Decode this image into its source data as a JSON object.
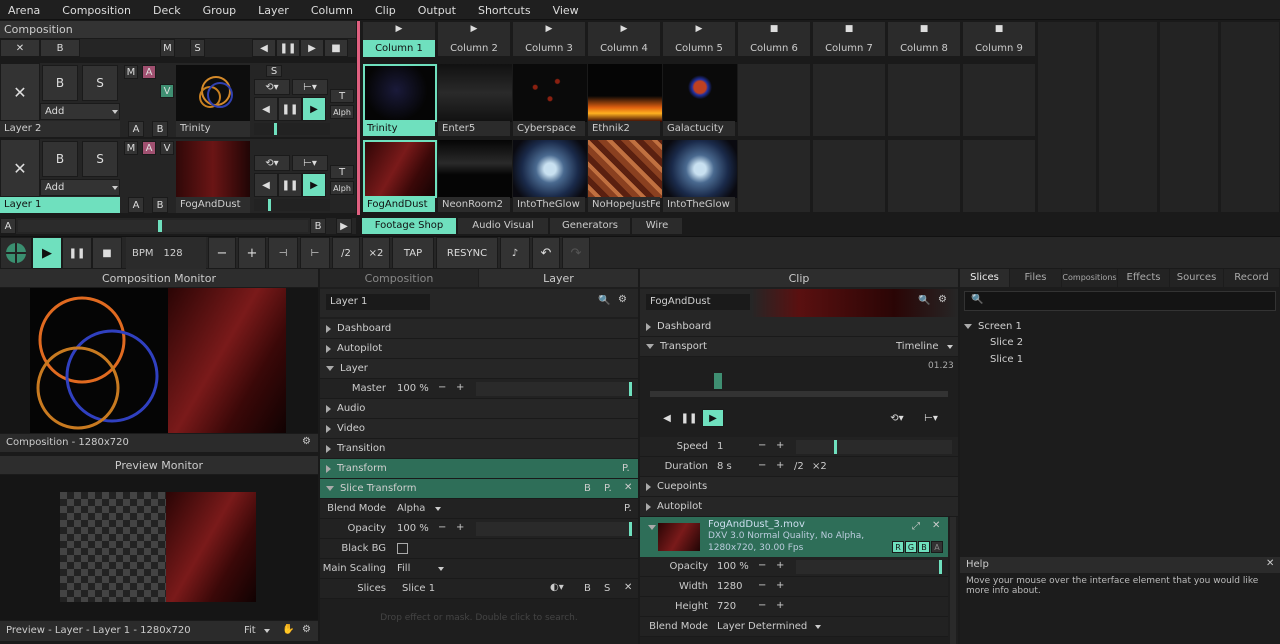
{
  "menu": [
    "Arena",
    "Composition",
    "Deck",
    "Group",
    "Layer",
    "Column",
    "Clip",
    "Output",
    "Shortcuts",
    "View"
  ],
  "composition_label": "Composition",
  "columns": [
    "Column 1",
    "Column 2",
    "Column 3",
    "Column 4",
    "Column 5",
    "Column 6",
    "Column 7",
    "Column 8",
    "Column 9"
  ],
  "layer2": {
    "name": "Layer 2",
    "add": "Add",
    "clip": "Trinity",
    "clips": [
      "Trinity",
      "Enter5",
      "Cyberspace",
      "Ethnik2",
      "Galactucity"
    ]
  },
  "layer1": {
    "name": "Layer 1",
    "add": "Add",
    "clip": "FogAndDust",
    "clips": [
      "FogAndDust",
      "NeonRoom2",
      "IntoTheGlow",
      "NoHopeJustFear",
      "IntoTheGlow"
    ]
  },
  "letters": {
    "b": "B",
    "s": "S",
    "m": "M",
    "a": "A",
    "v": "V",
    "t": "T",
    "alph": "Alph",
    "x": "✕"
  },
  "tabs_bottom": [
    "Footage Shop",
    "Audio Visual",
    "Generators",
    "Wire"
  ],
  "transport": {
    "bpm_label": "BPM",
    "bpm": "128",
    "minus": "−",
    "plus": "+",
    "half": "/2",
    "double": "×2",
    "tap": "TAP",
    "resync": "RESYNC"
  },
  "comp_monitor": {
    "title": "Composition Monitor",
    "footer": "Composition - 1280x720"
  },
  "preview_monitor": {
    "title": "Preview Monitor",
    "footer": "Preview - Layer - Layer 1 - 1280x720",
    "fit": "Fit"
  },
  "layer_panel": {
    "tab_comp": "Composition",
    "tab_layer": "Layer",
    "search": "Layer 1",
    "sections": [
      "Dashboard",
      "Autopilot",
      "Layer"
    ],
    "master_label": "Master",
    "master_val": "100 %",
    "sections2": [
      "Audio",
      "Video",
      "Transition",
      "Transform",
      "Slice Transform"
    ],
    "blend_label": "Blend Mode",
    "blend_val": "Alpha",
    "opacity_label": "Opacity",
    "opacity_val": "100 %",
    "blackbg_label": "Black BG",
    "scaling_label": "Main Scaling",
    "scaling_val": "Fill",
    "slices_label": "Slices",
    "slices_val": "Slice 1",
    "drop_hint": "Drop effect or mask. Double click to search."
  },
  "clip_panel": {
    "title": "Clip",
    "search": "FogAndDust",
    "dashboard": "Dashboard",
    "transport": "Transport",
    "timeline": "Timeline",
    "time": "01.23",
    "speed_label": "Speed",
    "speed_val": "1",
    "duration_label": "Duration",
    "duration_val": "8 s",
    "cuepoints": "Cuepoints",
    "autopilot": "Autopilot",
    "file": "FogAndDust_3.mov",
    "codec": "DXV 3.0 Normal Quality, No Alpha,",
    "res": "1280x720, 30.00 Fps",
    "rgb": [
      "R",
      "G",
      "B",
      "A"
    ],
    "opacity_label": "Opacity",
    "opacity_val": "100 %",
    "width_label": "Width",
    "width_val": "1280",
    "height_label": "Height",
    "height_val": "720",
    "blend_label": "Blend Mode",
    "blend_val": "Layer Determined"
  },
  "right_panel": {
    "tabs": [
      "Slices",
      "Files",
      "Compositions",
      "Effects",
      "Sources",
      "Record"
    ],
    "tree": [
      "Screen 1",
      "Slice 2",
      "Slice 1"
    ],
    "help_title": "Help",
    "help_text": "Move your mouse over the interface element that you would like more info about."
  }
}
